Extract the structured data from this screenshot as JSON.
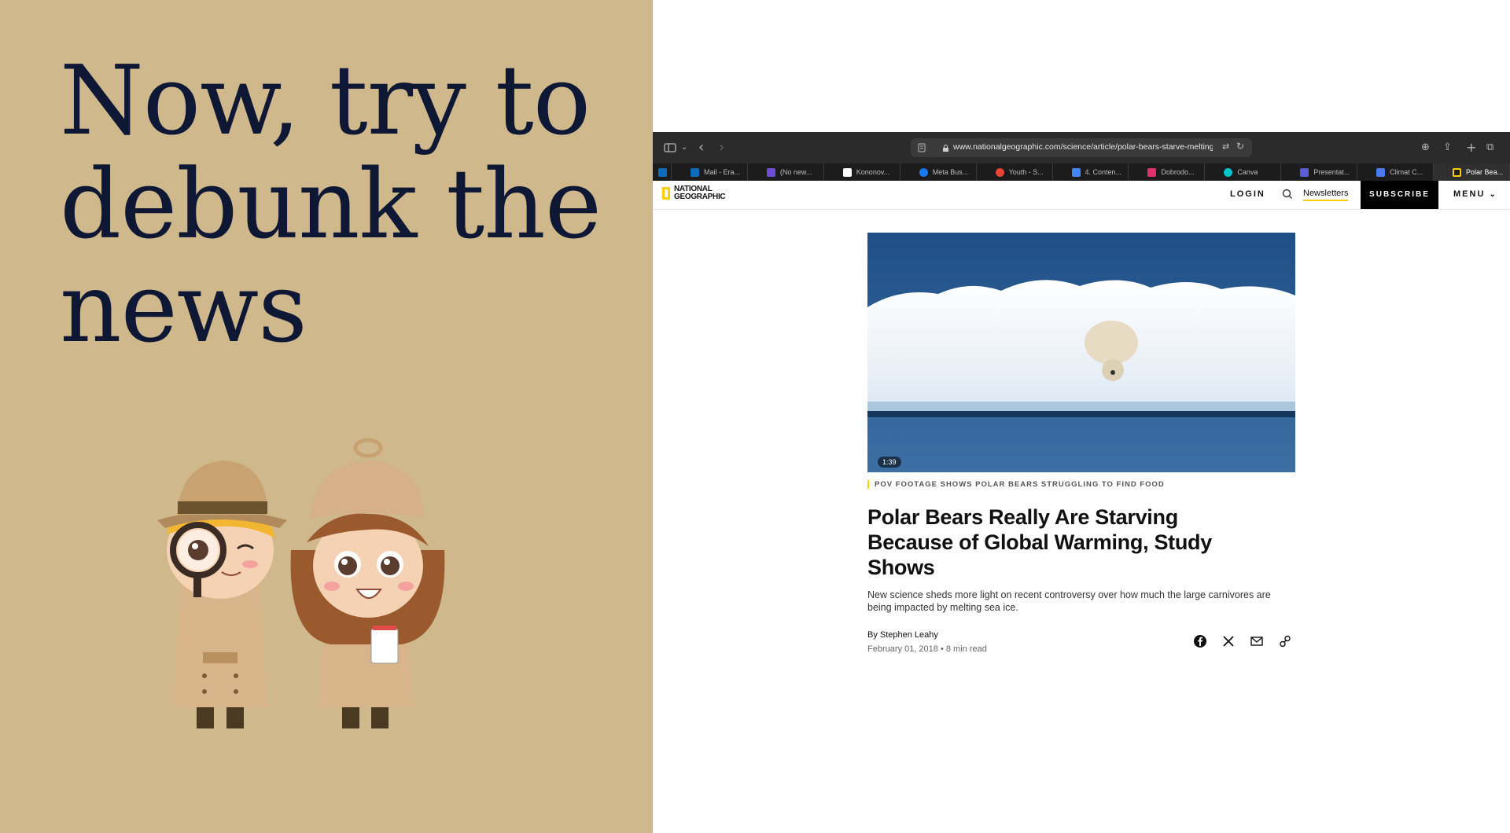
{
  "slide": {
    "title": "Now, try to debunk the news"
  },
  "browser": {
    "url": "www.nationalgeographic.com/science/article/polar-bears-starve-melting-s",
    "tabs": [
      {
        "label": "Mail - Era...",
        "color": "#0f6cbd"
      },
      {
        "label": "(No new...",
        "color": "#6e4bd8"
      },
      {
        "label": "Kononov...",
        "color": "#ffffff"
      },
      {
        "label": "Meta Bus...",
        "color": "#1877f2"
      },
      {
        "label": "Youth - S...",
        "color": "#ea4335"
      },
      {
        "label": "4. Conten...",
        "color": "#4285f4"
      },
      {
        "label": "Dobrodo...",
        "color": "#e1306c"
      },
      {
        "label": "Canva",
        "color": "#00c4cc"
      },
      {
        "label": "Presentat...",
        "color": "#5b5bd6"
      },
      {
        "label": "Climat C...",
        "color": "#4a7cf0"
      },
      {
        "label": "Polar Bea...",
        "color": "#ffce00"
      }
    ]
  },
  "site": {
    "logo": "NATIONAL GEOGRAPHIC",
    "login": "LOGIN",
    "newsletters": "Newsletters",
    "subscribe": "SUBSCRIBE",
    "menu": "MENU"
  },
  "article": {
    "video_duration": "1:39",
    "video_caption": "POV FOOTAGE SHOWS POLAR BEARS STRUGGLING TO FIND FOOD",
    "headline": "Polar Bears Really Are Starving Because of Global Warming, Study Shows",
    "dek": "New science sheds more light on recent controversy over how much the large carnivores are being impacted by melting sea ice.",
    "byline": "By Stephen Leahy",
    "date": "February 01, 2018",
    "read_time": "8 min read",
    "share_icons": [
      "facebook-icon",
      "x-icon",
      "mail-icon",
      "link-icon"
    ]
  },
  "colors": {
    "slide_bg": "#cfb88c",
    "slide_text": "#0e1733",
    "natgeo_yellow": "#ffce00"
  }
}
